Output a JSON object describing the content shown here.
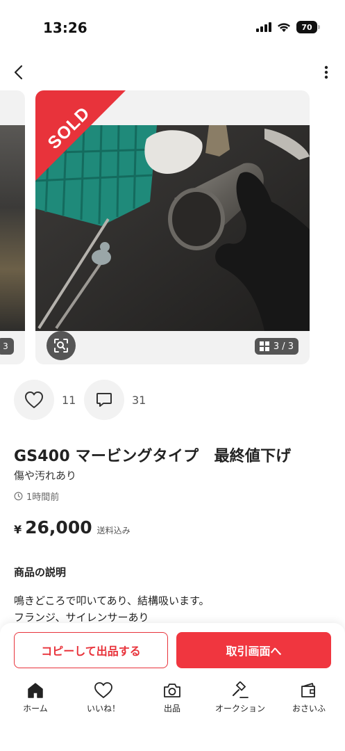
{
  "status_bar": {
    "time": "13:26",
    "battery": "70"
  },
  "carousel": {
    "sold_label": "SOLD",
    "prev_counter": "3",
    "counter": "3 / 3"
  },
  "actions": {
    "like_count": "11",
    "comment_count": "31"
  },
  "item": {
    "title": "GS400 マービングタイプ　最終値下げ",
    "condition": "傷や汚れあり",
    "posted": "1時間前",
    "currency": "¥",
    "price": "26,000",
    "shipping": "送料込み",
    "description_heading": "商品の説明",
    "description_lines": [
      "鳴きどころで叩いてあり、結構吸います。",
      "フランジ、サイレンサーあり"
    ]
  },
  "buttons": {
    "copy": "コピーして出品する",
    "trade": "取引画面へ"
  },
  "tabs": [
    {
      "label": "ホーム",
      "icon": "home-icon"
    },
    {
      "label": "いいね！",
      "icon": "heart-icon"
    },
    {
      "label": "出品",
      "icon": "camera-icon"
    },
    {
      "label": "オークション",
      "icon": "gavel-icon"
    },
    {
      "label": "おさいふ",
      "icon": "wallet-icon"
    }
  ],
  "colors": {
    "accent": "#e8333b",
    "trade_button": "#f0363f"
  }
}
